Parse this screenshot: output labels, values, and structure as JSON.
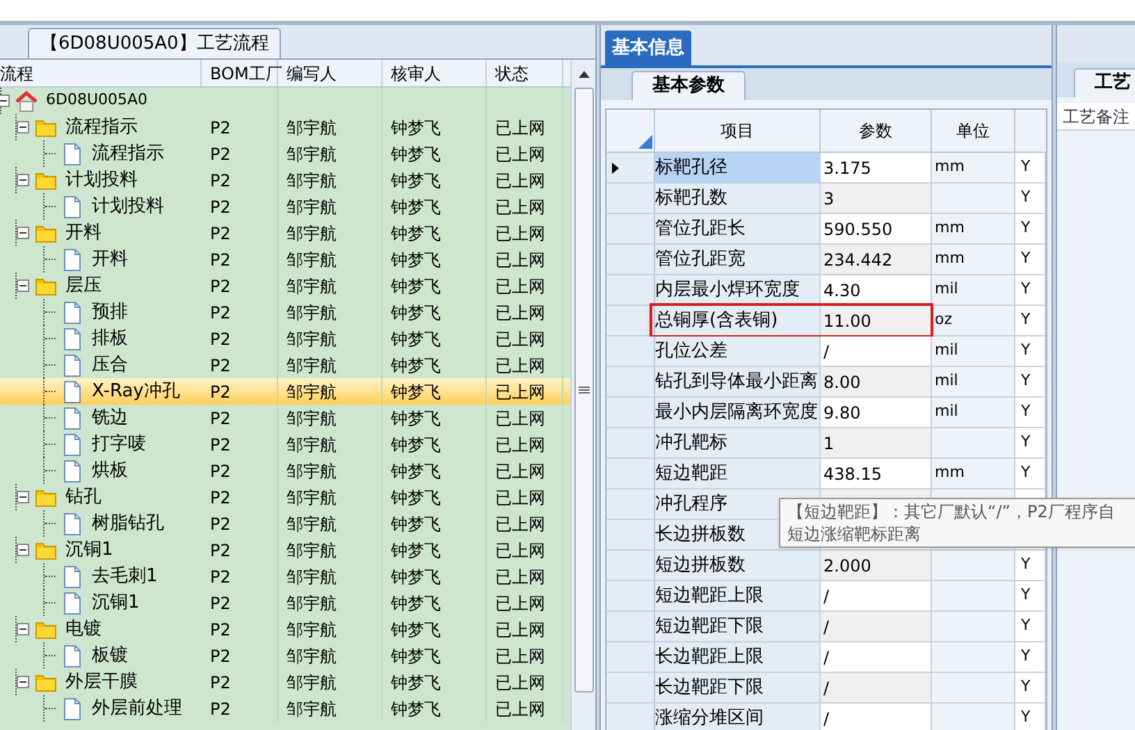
{
  "process_panel": {
    "tab": "【6D08U005A0】工艺流程",
    "columns": [
      "流程",
      "BOM工厂",
      "编写人",
      "核审人",
      "状态"
    ],
    "tree": [
      {
        "kind": "root",
        "name": "6D08U005A0",
        "expanded": true,
        "selected": false,
        "children": [
          {
            "kind": "folder",
            "name": "流程指示",
            "factory": "P2",
            "writer": "邹宇航",
            "reviewer": "钟梦飞",
            "status": "已上网",
            "expanded": true,
            "selected": false,
            "children": [
              {
                "kind": "file",
                "name": "流程指示",
                "factory": "P2",
                "writer": "邹宇航",
                "reviewer": "钟梦飞",
                "status": "已上网",
                "selected": false
              }
            ]
          },
          {
            "kind": "folder",
            "name": "计划投料",
            "factory": "P2",
            "writer": "邹宇航",
            "reviewer": "钟梦飞",
            "status": "已上网",
            "expanded": true,
            "selected": false,
            "children": [
              {
                "kind": "file",
                "name": "计划投料",
                "factory": "P2",
                "writer": "邹宇航",
                "reviewer": "钟梦飞",
                "status": "已上网",
                "selected": false
              }
            ]
          },
          {
            "kind": "folder",
            "name": "开料",
            "factory": "P2",
            "writer": "邹宇航",
            "reviewer": "钟梦飞",
            "status": "已上网",
            "expanded": true,
            "selected": false,
            "children": [
              {
                "kind": "file",
                "name": "开料",
                "factory": "P2",
                "writer": "邹宇航",
                "reviewer": "钟梦飞",
                "status": "已上网",
                "selected": false
              }
            ]
          },
          {
            "kind": "folder",
            "name": "层压",
            "factory": "P2",
            "writer": "邹宇航",
            "reviewer": "钟梦飞",
            "status": "已上网",
            "expanded": true,
            "selected": false,
            "children": [
              {
                "kind": "file",
                "name": "预排",
                "factory": "P2",
                "writer": "邹宇航",
                "reviewer": "钟梦飞",
                "status": "已上网",
                "selected": false
              },
              {
                "kind": "file",
                "name": "排板",
                "factory": "P2",
                "writer": "邹宇航",
                "reviewer": "钟梦飞",
                "status": "已上网",
                "selected": false
              },
              {
                "kind": "file",
                "name": "压合",
                "factory": "P2",
                "writer": "邹宇航",
                "reviewer": "钟梦飞",
                "status": "已上网",
                "selected": false
              },
              {
                "kind": "file",
                "name": "X-Ray冲孔",
                "factory": "P2",
                "writer": "邹宇航",
                "reviewer": "钟梦飞",
                "status": "已上网",
                "selected": true
              },
              {
                "kind": "file",
                "name": "铣边",
                "factory": "P2",
                "writer": "邹宇航",
                "reviewer": "钟梦飞",
                "status": "已上网",
                "selected": false
              },
              {
                "kind": "file",
                "name": "打字唛",
                "factory": "P2",
                "writer": "邹宇航",
                "reviewer": "钟梦飞",
                "status": "已上网",
                "selected": false
              },
              {
                "kind": "file",
                "name": "烘板",
                "factory": "P2",
                "writer": "邹宇航",
                "reviewer": "钟梦飞",
                "status": "已上网",
                "selected": false
              }
            ]
          },
          {
            "kind": "folder",
            "name": "钻孔",
            "factory": "P2",
            "writer": "邹宇航",
            "reviewer": "钟梦飞",
            "status": "已上网",
            "expanded": true,
            "selected": false,
            "children": [
              {
                "kind": "file",
                "name": "树脂钻孔",
                "factory": "P2",
                "writer": "邹宇航",
                "reviewer": "钟梦飞",
                "status": "已上网",
                "selected": false
              }
            ]
          },
          {
            "kind": "folder",
            "name": "沉铜1",
            "factory": "P2",
            "writer": "邹宇航",
            "reviewer": "钟梦飞",
            "status": "已上网",
            "expanded": true,
            "selected": false,
            "children": [
              {
                "kind": "file",
                "name": "去毛刺1",
                "factory": "P2",
                "writer": "邹宇航",
                "reviewer": "钟梦飞",
                "status": "已上网",
                "selected": false
              },
              {
                "kind": "file",
                "name": "沉铜1",
                "factory": "P2",
                "writer": "邹宇航",
                "reviewer": "钟梦飞",
                "status": "已上网",
                "selected": false
              }
            ]
          },
          {
            "kind": "folder",
            "name": "电镀",
            "factory": "P2",
            "writer": "邹宇航",
            "reviewer": "钟梦飞",
            "status": "已上网",
            "expanded": true,
            "selected": false,
            "children": [
              {
                "kind": "file",
                "name": "板镀",
                "factory": "P2",
                "writer": "邹宇航",
                "reviewer": "钟梦飞",
                "status": "已上网",
                "selected": false
              }
            ]
          },
          {
            "kind": "folder",
            "name": "外层干膜",
            "factory": "P2",
            "writer": "邹宇航",
            "reviewer": "钟梦飞",
            "status": "已上网",
            "expanded": true,
            "selected": false,
            "children": [
              {
                "kind": "file",
                "name": "外层前处理",
                "factory": "P2",
                "writer": "邹宇航",
                "reviewer": "钟梦飞",
                "status": "已上网",
                "selected": false
              }
            ]
          }
        ]
      }
    ]
  },
  "info_panel": {
    "tab": "基本信息",
    "subtab": "基本参数",
    "columns": [
      "项目",
      "参数",
      "单位"
    ],
    "rows": [
      {
        "item": "标靶孔径",
        "value": "3.175",
        "unit": "mm",
        "flag": "Y",
        "selected": true,
        "flagged": false
      },
      {
        "item": "标靶孔数",
        "value": "3",
        "flag": "Y",
        "selected": false,
        "flagged": false
      },
      {
        "item": "管位孔距长",
        "value": "590.550",
        "unit": "mm",
        "flag": "Y",
        "selected": false,
        "flagged": false
      },
      {
        "item": "管位孔距宽",
        "value": "234.442",
        "unit": "mm",
        "flag": "Y",
        "selected": false,
        "flagged": false
      },
      {
        "item": "内层最小焊环宽度",
        "value": "4.30",
        "unit": "mil",
        "flag": "Y",
        "selected": false,
        "flagged": false
      },
      {
        "item": "总铜厚(含表铜)",
        "value": "11.00",
        "unit": "oz",
        "flag": "Y",
        "selected": false,
        "flagged": true
      },
      {
        "item": "孔位公差",
        "value": "/",
        "unit": "mil",
        "flag": "Y",
        "selected": false,
        "flagged": false
      },
      {
        "item": "钻孔到导体最小距离",
        "value": "8.00",
        "unit": "mil",
        "flag": "Y",
        "selected": false,
        "flagged": false
      },
      {
        "item": "最小内层隔离环宽度",
        "value": "9.80",
        "unit": "mil",
        "flag": "Y",
        "selected": false,
        "flagged": false
      },
      {
        "item": "冲孔靶标",
        "value": "1",
        "flag": "Y",
        "selected": false,
        "flagged": false
      },
      {
        "item": "短边靶距",
        "value": "438.15",
        "unit": "mm",
        "flag": "Y",
        "selected": false,
        "flagged": false
      },
      {
        "item": "冲孔程序",
        "selected": false,
        "flagged": false
      },
      {
        "item": "长边拼板数",
        "selected": false,
        "flagged": false
      },
      {
        "item": "短边拼板数",
        "value": "2.000",
        "flag": "Y",
        "selected": false,
        "flagged": false
      },
      {
        "item": "短边靶距上限",
        "value": "/",
        "flag": "Y",
        "selected": false,
        "flagged": false
      },
      {
        "item": "短边靶距下限",
        "value": "/",
        "flag": "Y",
        "selected": false,
        "flagged": false
      },
      {
        "item": "长边靶距上限",
        "value": "/",
        "flag": "Y",
        "selected": false,
        "flagged": false
      },
      {
        "item": "长边靶距下限",
        "value": "/",
        "flag": "Y",
        "selected": false,
        "flagged": false
      },
      {
        "item": "涨缩分堆区间",
        "value": "/",
        "flag": "Y",
        "selected": false,
        "flagged": false
      }
    ],
    "tooltip": [
      "【短边靶距】：其它厂默认“/”，P2厂程序自",
      "短边涨缩靶标距离"
    ]
  },
  "notes_panel": {
    "tab": "工艺",
    "field_label": "工艺备注"
  }
}
